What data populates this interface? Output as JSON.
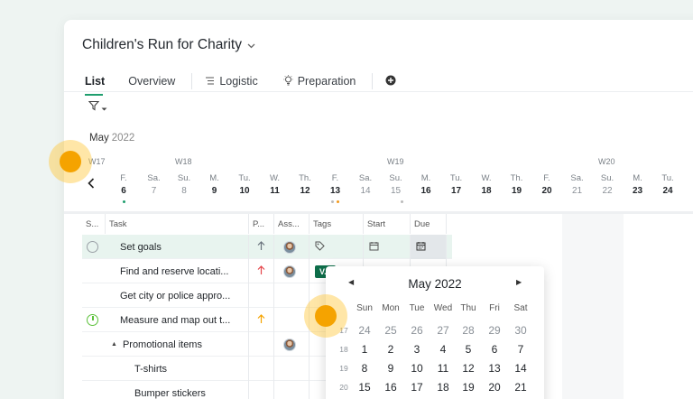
{
  "project": {
    "title": "Children's Run for Charity",
    "caret_icon": "chevron-down-icon"
  },
  "tabs": [
    {
      "label": "List",
      "active": true
    },
    {
      "label": "Overview"
    },
    {
      "label": "Logistic",
      "icon": "list-icon"
    },
    {
      "label": "Preparation",
      "icon": "lightbulb-icon"
    },
    {
      "label": "",
      "icon": "add-circle-icon"
    }
  ],
  "filter": {
    "icon": "filter-icon"
  },
  "timeline": {
    "month": "May",
    "year": "2022",
    "weeks": [
      "W17",
      "W18",
      "W19",
      "W20"
    ],
    "days": [
      {
        "name": "F.",
        "date": "6",
        "weekend": false
      },
      {
        "name": "Sa.",
        "date": "7",
        "weekend": true
      },
      {
        "name": "Su.",
        "date": "8",
        "weekend": true
      },
      {
        "name": "M.",
        "date": "9",
        "weekend": false
      },
      {
        "name": "Tu.",
        "date": "10",
        "weekend": false
      },
      {
        "name": "W.",
        "date": "11",
        "weekend": false
      },
      {
        "name": "Th.",
        "date": "12",
        "weekend": false
      },
      {
        "name": "F.",
        "date": "13",
        "weekend": false
      },
      {
        "name": "Sa.",
        "date": "14",
        "weekend": true
      },
      {
        "name": "Su.",
        "date": "15",
        "weekend": true
      },
      {
        "name": "M.",
        "date": "16",
        "weekend": false
      },
      {
        "name": "Tu.",
        "date": "17",
        "weekend": false
      },
      {
        "name": "W.",
        "date": "18",
        "weekend": false
      },
      {
        "name": "Th.",
        "date": "19",
        "weekend": false
      },
      {
        "name": "F.",
        "date": "20",
        "weekend": false
      },
      {
        "name": "Sa.",
        "date": "21",
        "weekend": true
      },
      {
        "name": "Su.",
        "date": "22",
        "weekend": true
      },
      {
        "name": "M.",
        "date": "23",
        "weekend": false
      },
      {
        "name": "Tu.",
        "date": "24",
        "weekend": false
      }
    ]
  },
  "table": {
    "headers": [
      "S...",
      "Task",
      "P...",
      "Ass...",
      "Tags",
      "Start",
      "Due"
    ],
    "rows": [
      {
        "task": "Set goals",
        "status": "open",
        "priority": "up-gray",
        "avatar": true,
        "tag": "tag-icon",
        "highlight": true
      },
      {
        "task": "Find and reserve locati...",
        "status": "",
        "priority": "up-red",
        "avatar": true,
        "tag_label": "V..."
      },
      {
        "task": "Get city or police appro...",
        "status": ""
      },
      {
        "task": "Measure and map out t...",
        "status": "progress",
        "priority": "up-orange"
      },
      {
        "task": "Promotional items",
        "status": "",
        "group": true,
        "avatar": true
      },
      {
        "task": "T-shirts",
        "status": "",
        "indent": true
      },
      {
        "task": "Bumper stickers",
        "status": "",
        "indent": true
      }
    ]
  },
  "datepicker": {
    "title": "May 2022",
    "prev_icon": "caret-left-icon",
    "next_icon": "caret-right-icon",
    "weekdays": [
      "Sun",
      "Mon",
      "Tue",
      "Wed",
      "Thu",
      "Fri",
      "Sat"
    ],
    "weeks": [
      {
        "num": "17",
        "days": [
          "24",
          "25",
          "26",
          "27",
          "28",
          "29",
          "30"
        ],
        "muted": true
      },
      {
        "num": "18",
        "days": [
          "1",
          "2",
          "3",
          "4",
          "5",
          "6",
          "7"
        ]
      },
      {
        "num": "19",
        "days": [
          "8",
          "9",
          "10",
          "11",
          "12",
          "13",
          "14"
        ]
      },
      {
        "num": "20",
        "days": [
          "15",
          "16",
          "17",
          "18",
          "19",
          "20",
          "21"
        ]
      }
    ]
  },
  "colors": {
    "accent": "#1f9e6e",
    "highlight_row": "#e8f4ef",
    "tag": "#0e6e4a",
    "cursor": "#f5a300"
  }
}
